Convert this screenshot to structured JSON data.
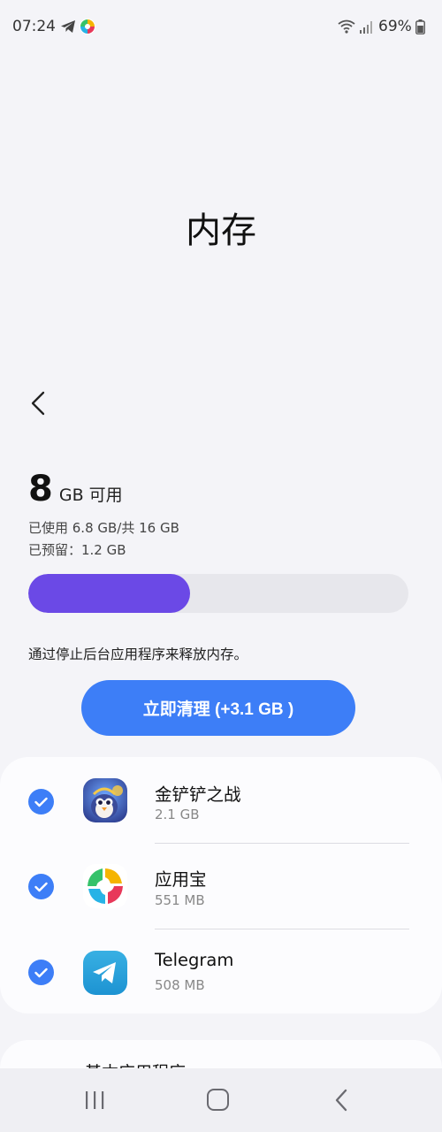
{
  "status_bar": {
    "time": "07:24",
    "battery": "69%",
    "icons": [
      "telegram-icon",
      "yingyongbao-icon",
      "wifi-icon",
      "signal-icon",
      "battery-icon"
    ]
  },
  "page": {
    "title": "内存",
    "back_icon": "chevron-left-icon"
  },
  "memory": {
    "available_value": "8",
    "available_unit": "GB 可用",
    "used_text": "已使用 6.8 GB/共 16 GB",
    "reserved_text": "已预留：1.2 GB",
    "usage_fraction": 0.425,
    "bar_color": "#6b49e6"
  },
  "hint": "通过停止后台应用程序来释放内存。",
  "clean_button": {
    "label": "立即清理 (+3.1 GB )",
    "color": "#3d7ef7"
  },
  "apps": [
    {
      "name": "金铲铲之战",
      "size": "2.1 GB",
      "checked": true,
      "icon": "jinchanchan-icon"
    },
    {
      "name": "应用宝",
      "size": "551 MB",
      "checked": true,
      "icon": "yingyongbao-icon"
    },
    {
      "name": "Telegram",
      "size": "508 MB",
      "checked": true,
      "icon": "telegram-icon"
    }
  ],
  "section2": {
    "title": "基本应用程序"
  },
  "nav": {
    "icons": [
      "recent-apps-icon",
      "home-icon",
      "back-icon"
    ]
  }
}
